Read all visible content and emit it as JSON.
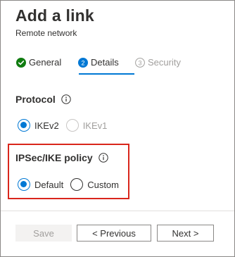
{
  "header": {
    "title": "Add a link",
    "subtitle": "Remote network"
  },
  "tabs": [
    {
      "label": "General",
      "state": "completed",
      "icon": "check-circle-icon"
    },
    {
      "number": "2",
      "label": "Details",
      "state": "active"
    },
    {
      "number": "3",
      "label": "Security",
      "state": "disabled"
    }
  ],
  "protocol": {
    "label": "Protocol",
    "options": [
      {
        "label": "IKEv2",
        "checked": true,
        "disabled": false
      },
      {
        "label": "IKEv1",
        "checked": false,
        "disabled": true
      }
    ]
  },
  "policy": {
    "label": "IPSec/IKE policy",
    "options": [
      {
        "label": "Default",
        "checked": true
      },
      {
        "label": "Custom",
        "checked": false
      }
    ]
  },
  "footer": {
    "save_label": "Save",
    "previous_label": "< Previous",
    "next_label": "Next >"
  },
  "colors": {
    "accent": "#0078d4",
    "success": "#107c10",
    "highlight": "#d9261c",
    "disabled": "#a19f9d"
  }
}
